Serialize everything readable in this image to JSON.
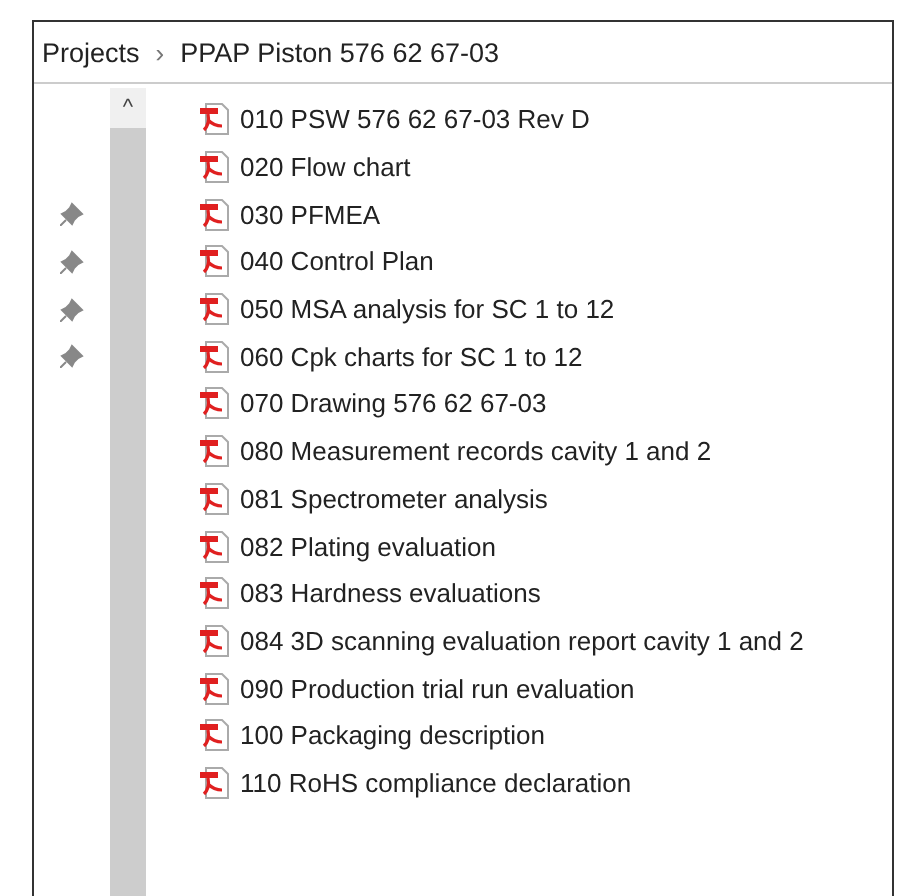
{
  "breadcrumb": [
    {
      "label": "Projects",
      "separator": "›"
    },
    {
      "label": "PPAP Piston 576 62 67-03"
    }
  ],
  "scroll_up": "^",
  "nav_rows": [
    {
      "pinned": false
    },
    {
      "pinned": false
    },
    {
      "pinned": true
    },
    {
      "pinned": true
    },
    {
      "pinned": true
    },
    {
      "pinned": true
    },
    {
      "pinned": false
    },
    {
      "pinned": false
    },
    {
      "pinned": false
    },
    {
      "pinned": false
    },
    {
      "pinned": false
    },
    {
      "pinned": false
    },
    {
      "pinned": false
    },
    {
      "pinned": false
    },
    {
      "pinned": false
    },
    {
      "pinned": false
    }
  ],
  "files": [
    {
      "name": "010 PSW 576 62 67-03 Rev D",
      "kind": "pdf"
    },
    {
      "name": "020 Flow chart",
      "kind": "pdf"
    },
    {
      "name": "030 PFMEA",
      "kind": "pdf"
    },
    {
      "name": "040 Control Plan",
      "kind": "pdf"
    },
    {
      "name": "050 MSA analysis for SC 1 to 12",
      "kind": "pdf"
    },
    {
      "name": "060 Cpk charts for SC 1 to 12",
      "kind": "pdf"
    },
    {
      "name": "070 Drawing 576 62 67-03",
      "kind": "pdf"
    },
    {
      "name": "080 Measurement records cavity 1 and 2",
      "kind": "pdf"
    },
    {
      "name": "081 Spectrometer analysis",
      "kind": "pdf"
    },
    {
      "name": "082 Plating evaluation",
      "kind": "pdf"
    },
    {
      "name": "083 Hardness evaluations",
      "kind": "pdf"
    },
    {
      "name": "084 3D scanning evaluation report cavity 1 and 2",
      "kind": "pdf"
    },
    {
      "name": "090 Production trial run evaluation",
      "kind": "pdf"
    },
    {
      "name": "100 Packaging description",
      "kind": "pdf"
    },
    {
      "name": "110 RoHS compliance declaration",
      "kind": "pdf"
    }
  ]
}
